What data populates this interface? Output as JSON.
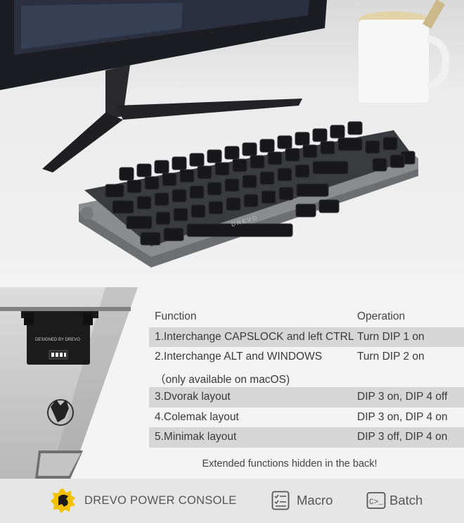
{
  "table": {
    "header": {
      "function": "Function",
      "operation": "Operation"
    },
    "rows": [
      {
        "function": "1.Interchange CAPSLOCK and left CTRL",
        "operation": "Turn DIP 1 on"
      },
      {
        "function": "2.Interchange ALT and WINDOWS",
        "operation": "Turn DIP 2 on"
      },
      {
        "function": "（only available on macOS)",
        "operation": ""
      },
      {
        "function": "3.Dvorak layout",
        "operation": "DIP 3 on, DIP 4 off"
      },
      {
        "function": "4.Colemak layout",
        "operation": "DIP 3 on, DIP 4 on"
      },
      {
        "function": "5.Minimak layout",
        "operation": "DIP 3 off, DIP 4 on"
      }
    ]
  },
  "note": "Extended functions hidden in the back!",
  "footer": {
    "brand": "DREVO POWER CONSOLE",
    "macro": "Macro",
    "batch": "Batch"
  },
  "photo": {
    "device_text": "DESIGNED BY DREVO",
    "keyboard_text": "D R E V O"
  },
  "colors": {
    "row_shade": "#d6d6d6",
    "logo_yellow": "#f2c200"
  }
}
